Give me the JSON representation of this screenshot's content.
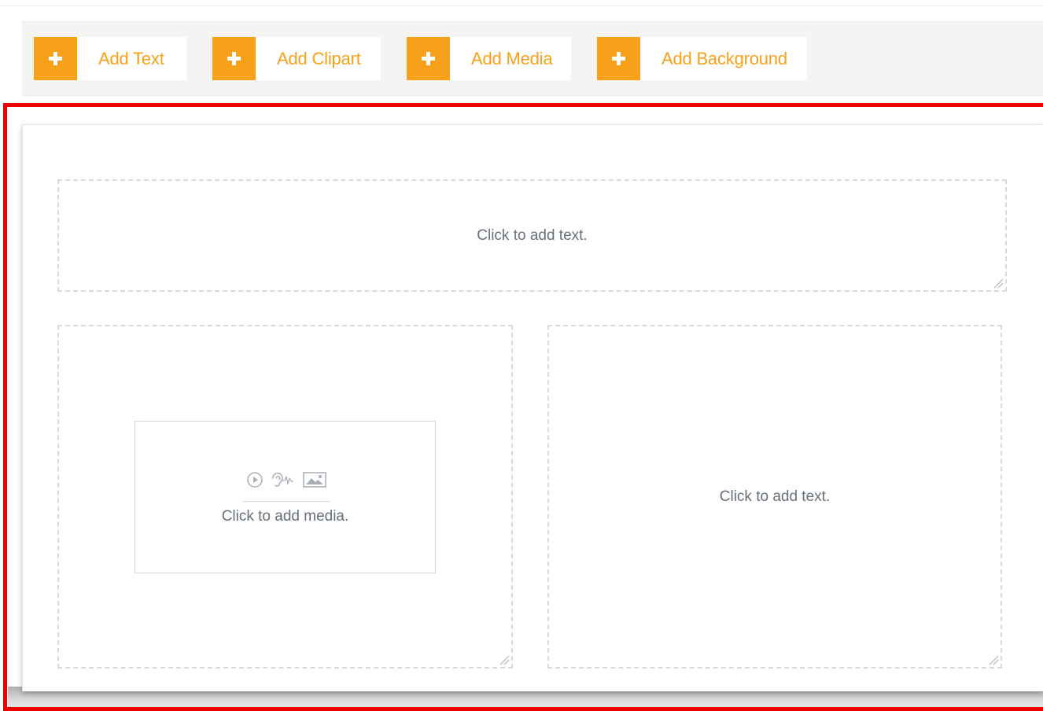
{
  "toolbar": {
    "add_text_label": "Add Text",
    "add_clipart_label": "Add Clipart",
    "add_media_label": "Add Media",
    "add_background_label": "Add Background"
  },
  "canvas": {
    "top_zone_placeholder": "Click to add text.",
    "media_zone_placeholder": "Click to add media.",
    "right_zone_placeholder": "Click to add text."
  },
  "icons": {
    "add": "plus-icon",
    "media": [
      "play-icon",
      "audio-icon",
      "image-icon"
    ],
    "resize": "resize-grip-icon"
  },
  "colors": {
    "accent": "#f7a11a",
    "highlight_frame": "#ee0000",
    "placeholder_text": "#68707a",
    "dashed_border": "#dadada"
  }
}
